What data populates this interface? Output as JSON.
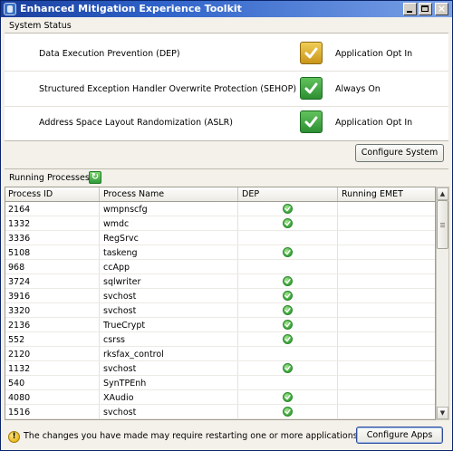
{
  "window": {
    "title": "Enhanced Mitigation Experience Toolkit"
  },
  "system_status": {
    "title": "System Status",
    "rows": [
      {
        "label": "Data Execution Prevention (DEP)",
        "value": "Application Opt In",
        "indicator": "yellow-check"
      },
      {
        "label": "Structured Exception Handler Overwrite Protection (SEHOP)",
        "value": "Always On",
        "indicator": "green-check"
      },
      {
        "label": "Address Space Layout Randomization (ASLR)",
        "value": "Application Opt In",
        "indicator": "green-check"
      }
    ],
    "configure_button": "Configure System"
  },
  "running_processes": {
    "title": "Running Processes",
    "columns": [
      "Process ID",
      "Process Name",
      "DEP",
      "Running EMET"
    ],
    "rows": [
      {
        "pid": "2164",
        "name": "wmpnscfg",
        "dep": true
      },
      {
        "pid": "1332",
        "name": "wmdc",
        "dep": true
      },
      {
        "pid": "3336",
        "name": "RegSrvc",
        "dep": false
      },
      {
        "pid": "5108",
        "name": "taskeng",
        "dep": true
      },
      {
        "pid": "968",
        "name": "ccApp",
        "dep": false
      },
      {
        "pid": "3724",
        "name": "sqlwriter",
        "dep": true
      },
      {
        "pid": "3916",
        "name": "svchost",
        "dep": true
      },
      {
        "pid": "3320",
        "name": "svchost",
        "dep": true
      },
      {
        "pid": "2136",
        "name": "TrueCrypt",
        "dep": true
      },
      {
        "pid": "552",
        "name": "csrss",
        "dep": true
      },
      {
        "pid": "2120",
        "name": "rksfax_control",
        "dep": false
      },
      {
        "pid": "1132",
        "name": "svchost",
        "dep": true
      },
      {
        "pid": "540",
        "name": "SynTPEnh",
        "dep": false
      },
      {
        "pid": "4080",
        "name": "XAudio",
        "dep": true
      },
      {
        "pid": "1516",
        "name": "svchost",
        "dep": true
      }
    ]
  },
  "footer": {
    "warning": "The changes you have made may require restarting one or more applications",
    "configure_apps_button": "Configure Apps"
  },
  "colors": {
    "green": "#2d8f32",
    "yellow": "#c9961a",
    "titlebar": "#1a3f9e"
  }
}
